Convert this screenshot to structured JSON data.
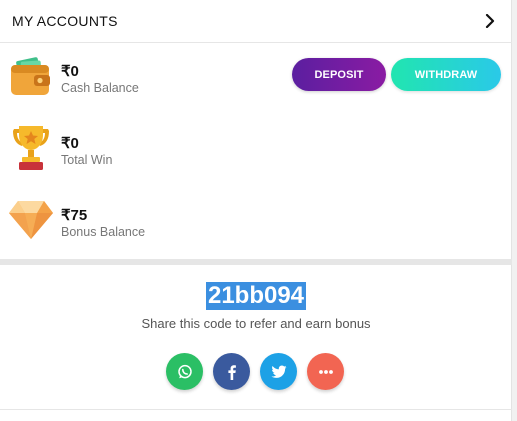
{
  "accounts": {
    "title": "MY ACCOUNTS",
    "chevron_icon": "chevron-right-icon"
  },
  "balances": [
    {
      "icon": "wallet-icon",
      "amount": "₹0",
      "label": "Cash Balance"
    },
    {
      "icon": "trophy-icon",
      "amount": "₹0",
      "label": "Total Win"
    },
    {
      "icon": "diamond-icon",
      "amount": "₹75",
      "label": "Bonus Balance"
    }
  ],
  "actions": {
    "deposit_label": "DEPOSIT",
    "withdraw_label": "WITHDRAW"
  },
  "referral": {
    "code": "21bb094",
    "description": "Share this code to refer and earn bonus"
  },
  "share": [
    {
      "icon": "whatsapp-icon",
      "color": "#2bbf65"
    },
    {
      "icon": "facebook-icon",
      "color": "#3a5a9e"
    },
    {
      "icon": "twitter-icon",
      "color": "#1da1e6"
    },
    {
      "icon": "more-icon",
      "color": "#f26552"
    }
  ],
  "colors": {
    "deposit_gradient": [
      "#5b1fa0",
      "#8a1ba3"
    ],
    "withdraw_gradient": [
      "#21e5b0",
      "#2ac9e8"
    ],
    "code_highlight": "#3b8fe0"
  }
}
